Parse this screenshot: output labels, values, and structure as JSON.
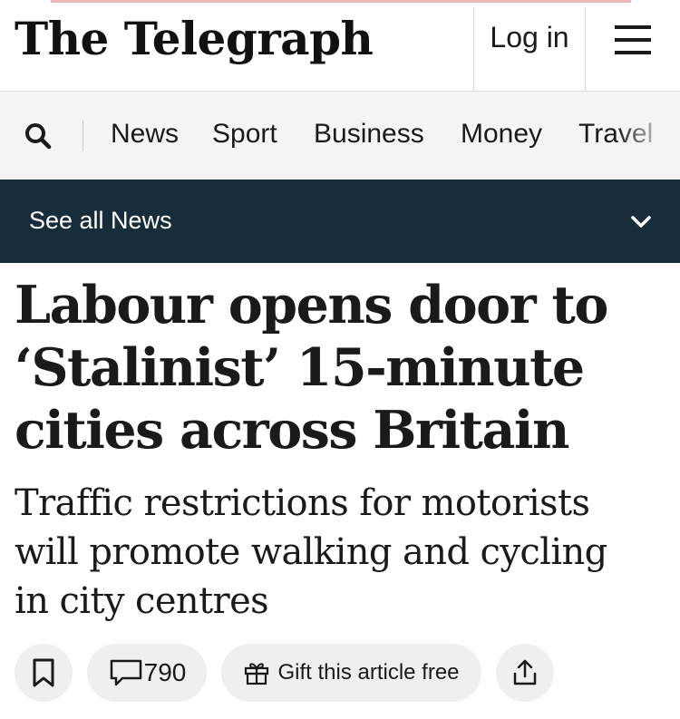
{
  "masthead": {
    "logo_text": "The Telegraph",
    "login_label": "Log in",
    "menu_icon": "hamburger-menu-icon"
  },
  "nav": {
    "search_icon": "search-icon",
    "items": [
      "News",
      "Sport",
      "Business",
      "Money",
      "Travel"
    ]
  },
  "section_bar": {
    "label": "See all News",
    "icon": "chevron-down-icon",
    "background": "#172d3b"
  },
  "article": {
    "headline_lines": [
      "Labour opens door to",
      "‘Stalinist’ 15-minute",
      "cities across Britain"
    ],
    "standfirst_lines": [
      "Traffic restrictions for motorists",
      "will promote walking and cycling",
      "in city centres"
    ]
  },
  "actions": {
    "bookmark_icon": "bookmark-icon",
    "comments_icon": "comment-icon",
    "comment_count": "790",
    "gift_icon": "gift-icon",
    "gift_label": "Gift this article free",
    "share_icon": "share-icon"
  }
}
